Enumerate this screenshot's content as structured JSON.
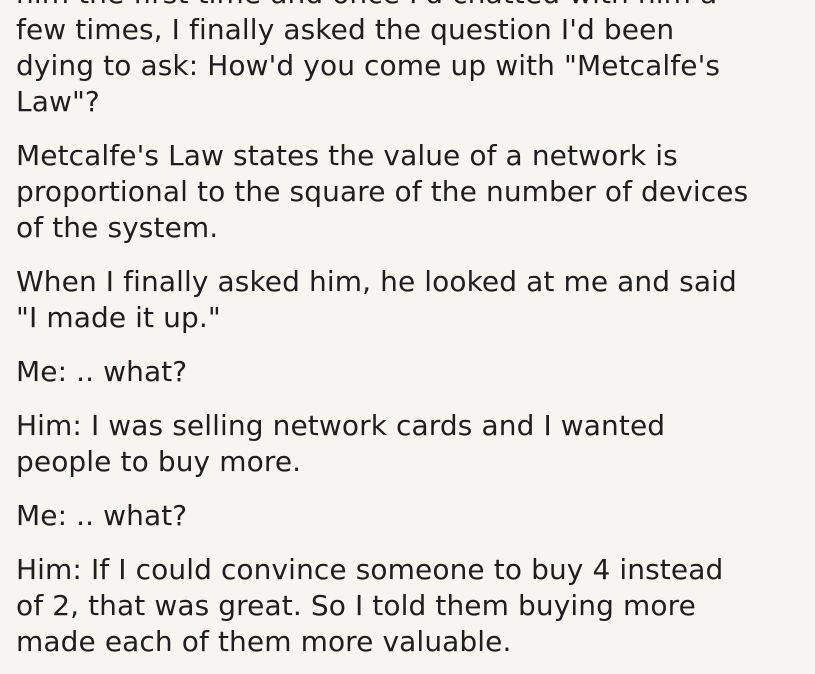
{
  "paragraphs": [
    {
      "lines": [
        "him the first time and once I'd chatted with him a",
        "few times, I finally asked the question I'd been",
        "dying to ask: How'd you come up with \"Metcalfe's",
        "Law\"?"
      ]
    },
    {
      "lines": [
        "Metcalfe's Law states the value of a network is",
        "proportional to the square of the number of devices",
        "of the system."
      ]
    },
    {
      "lines": [
        "When I finally asked him, he looked at me and said",
        "\"I made it up.\""
      ]
    },
    {
      "lines": [
        "Me: .. what?"
      ]
    },
    {
      "lines": [
        "Him: I was selling network cards and I wanted",
        "people to buy more."
      ]
    },
    {
      "lines": [
        "Me: .. what?"
      ]
    },
    {
      "lines": [
        "Him: If I could convince someone to buy 4 instead",
        "of 2, that was great. So I told them buying more",
        "made each of them more valuable."
      ]
    }
  ]
}
